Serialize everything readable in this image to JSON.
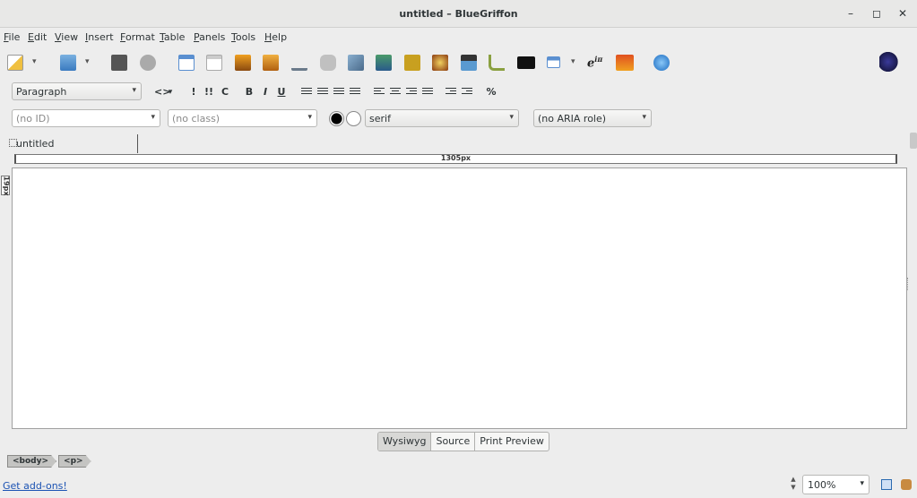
{
  "window": {
    "title": "untitled – BlueGriffon",
    "minimize": "–",
    "maximize": "◻",
    "close": "✕"
  },
  "menu": [
    "File",
    "Edit",
    "View",
    "Insert",
    "Format",
    "Table",
    "Panels",
    "Tools",
    "Help"
  ],
  "format_bar": {
    "paragraph": "Paragraph",
    "buttons": {
      "code": "<>",
      "em": "!",
      "strong": "!!",
      "cite": "C",
      "bold": "B",
      "italic": "I",
      "underline": "U",
      "clear": "%"
    }
  },
  "props_bar": {
    "id_placeholder": "(no ID)",
    "class_placeholder": "(no class)",
    "font": "serif",
    "aria": "(no ARIA role)"
  },
  "tab": {
    "label": "untitled"
  },
  "ruler": {
    "width_label": "1305px",
    "height_label": "19px"
  },
  "view_modes": [
    "Wysiwyg",
    "Source",
    "Print Preview"
  ],
  "structure": [
    "<body>",
    "<p>"
  ],
  "status": {
    "addons_link": "Get add-ons!",
    "zoom": "100%"
  },
  "colors": {
    "accent_blue": "#1a52b3",
    "canvas": "#ffffff",
    "chrome": "#ededed"
  }
}
